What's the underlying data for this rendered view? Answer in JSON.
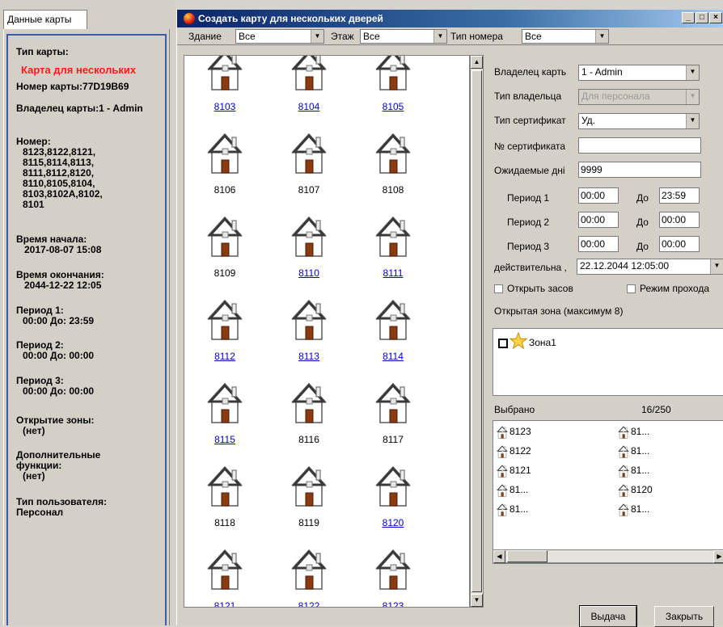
{
  "left_panel": {
    "tab": "Данные карты",
    "card_type_label": "Тип карты:",
    "card_type_value": "Карта для нескольких",
    "card_number": "Номер карты:77D19B69",
    "owner": "Владелец карты:1 - Admin",
    "rooms_label": "Номер:",
    "rooms_lines": [
      "8123,8122,8121,",
      "8115,8114,8113,",
      "8111,8112,8120,",
      "8110,8105,8104,",
      "8103,8102A,8102,",
      "8101"
    ],
    "start_label": "Время начала:",
    "start_value": "2017-08-07 15:08",
    "end_label": "Время окончания:",
    "end_value": "2044-12-22 12:05",
    "p1_label": "Период 1:",
    "p1_value": "00:00 До: 23:59",
    "p2_label": "Период 2:",
    "p2_value": "00:00 До: 00:00",
    "p3_label": "Период 3:",
    "p3_value": "00:00 До: 00:00",
    "zones_label": "Открытие зоны:",
    "zones_value": "(нет)",
    "extra_label1": "Дополнительные",
    "extra_label2": "функции:",
    "extra_value": "(нет)",
    "usertype_label": "Тип пользователя:",
    "usertype_value": "Персонал"
  },
  "window": {
    "title": "Создать карту для нескольких дверей",
    "min": "_",
    "max": "□",
    "close": "×"
  },
  "filters": {
    "building_label": "Здание",
    "building_value": "Все",
    "floor_label": "Этаж",
    "floor_value": "Все",
    "roomtype_label": "Тип номера",
    "roomtype_value": "Все"
  },
  "rooms": [
    {
      "n": "8103",
      "sel": true
    },
    {
      "n": "8104",
      "sel": true
    },
    {
      "n": "8105",
      "sel": true
    },
    {
      "n": "8106",
      "sel": false
    },
    {
      "n": "8107",
      "sel": false
    },
    {
      "n": "8108",
      "sel": false
    },
    {
      "n": "8109",
      "sel": false
    },
    {
      "n": "8110",
      "sel": true
    },
    {
      "n": "8111",
      "sel": true
    },
    {
      "n": "8112",
      "sel": true
    },
    {
      "n": "8113",
      "sel": true
    },
    {
      "n": "8114",
      "sel": true
    },
    {
      "n": "8115",
      "sel": true
    },
    {
      "n": "8116",
      "sel": false
    },
    {
      "n": "8117",
      "sel": false
    },
    {
      "n": "8118",
      "sel": false
    },
    {
      "n": "8119",
      "sel": false
    },
    {
      "n": "8120",
      "sel": true
    },
    {
      "n": "8121",
      "sel": true
    },
    {
      "n": "8122",
      "sel": true
    },
    {
      "n": "8123",
      "sel": true
    }
  ],
  "form": {
    "owner_label": "Владелец карть",
    "owner_value": "1 - Admin",
    "owner_type_label": "Тип владельца",
    "owner_type_value": "Для персонала",
    "cert_type_label": "Тип сертификат",
    "cert_type_value": "Уд.",
    "cert_no_label": "№ сертификата",
    "cert_no_value": "",
    "days_label": "Ожидаемые дні",
    "days_value": "9999",
    "period1_label": "Период 1",
    "period1_from": "00:00",
    "period1_to": "23:59",
    "period2_label": "Период 2",
    "period2_from": "00:00",
    "period2_to": "00:00",
    "period3_label": "Период 3",
    "period3_from": "00:00",
    "period3_to": "00:00",
    "to_label": "До",
    "valid_label": "действительна ,",
    "valid_value": "22.12.2044 12:05:00",
    "open_bolt": "Открыть засов",
    "pass_mode": "Режим прохода",
    "zone_title": "Открытая зона (максимум 8)",
    "zone1": "Зона1",
    "selected_label": "Выбрано",
    "selected_count": "16/250",
    "selected_col1": [
      "8123",
      "8122",
      "8121",
      "81...",
      "81..."
    ],
    "selected_col2": [
      "81...",
      "81...",
      "81...",
      "8120",
      "81..."
    ],
    "issue_btn": "Выдача",
    "close_btn": "Закрыть"
  }
}
